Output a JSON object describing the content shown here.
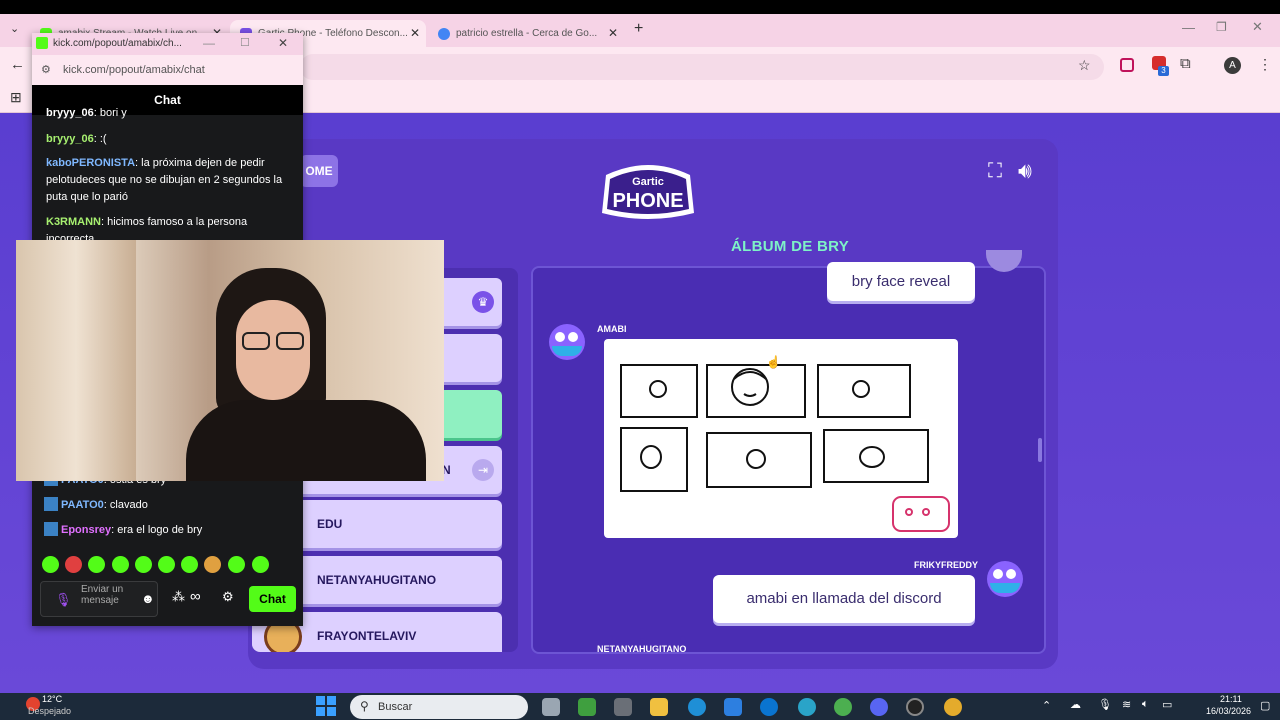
{
  "browser": {
    "tabs": [
      {
        "label": "amabix Stream - Watch Live on..."
      },
      {
        "label": "Gartic Phone - Teléfono Descon..."
      },
      {
        "label": "patricio estrella - Cerca de Go..."
      }
    ],
    "new_tab": "+",
    "profile_initial": "A",
    "extension_badge": "3"
  },
  "kick": {
    "window_title": "kick.com/popout/amabix/ch...",
    "url": "kick.com/popout/amabix/chat",
    "chat_header": "Chat",
    "messages_top": [
      {
        "user": "bryyy_06",
        "text": "bori y",
        "color": "#ffffff"
      },
      {
        "user": "bryyy_06",
        "text": ":(",
        "color": "#a7f070"
      },
      {
        "user": "kaboPERONISTA",
        "text": "la próxima dejen de pedir pelotudeces que no se dibujan en 2 segundos la puta que lo parió",
        "color": "#7fb8ff"
      },
      {
        "user": "K3RMANN",
        "text": "hicimos famoso a la persona incorrecta",
        "color": "#a7f070"
      }
    ],
    "messages_bottom": [
      {
        "user": "PAATO0",
        "text": "ostia es bry",
        "color": "#7fb8ff"
      },
      {
        "user": "PAATO0",
        "text": "clavado",
        "color": "#7fb8ff"
      },
      {
        "user": "Eponsrey",
        "text": "era el logo de bry",
        "color": "#e070ff"
      }
    ],
    "input_placeholder": "Enviar un mensaje",
    "send_label": "Chat",
    "infinity_symbol": "∞"
  },
  "game": {
    "home_label": "OME",
    "logo_top": "Gartic",
    "logo_bottom": "PHONE",
    "album_title": "ÁLBUM DE BRY",
    "players": [
      {
        "name": ""
      },
      {
        "name": ""
      },
      {
        "name": ""
      },
      {
        "name": "N"
      },
      {
        "name": "EDU"
      },
      {
        "name": "NETANYAHUGITANO"
      },
      {
        "name": "FRAYONTELAVIV"
      }
    ],
    "entries": {
      "first_text": "bry face reveal",
      "drawing_author": "AMABI",
      "second_author": "FRIKYFREDDY",
      "second_text": "amabi en llamada del discord",
      "next_author": "NETANYAHUGITANO"
    }
  },
  "taskbar": {
    "weather_temp": "12°C",
    "weather_desc": "Despejado",
    "search_placeholder": "Buscar",
    "time": "21:11",
    "date": "16/03/2026"
  },
  "colors": {
    "kick_green": "#53fc18",
    "gartic_bg": "#5a3ed0",
    "album_title": "#7ef2c7"
  }
}
